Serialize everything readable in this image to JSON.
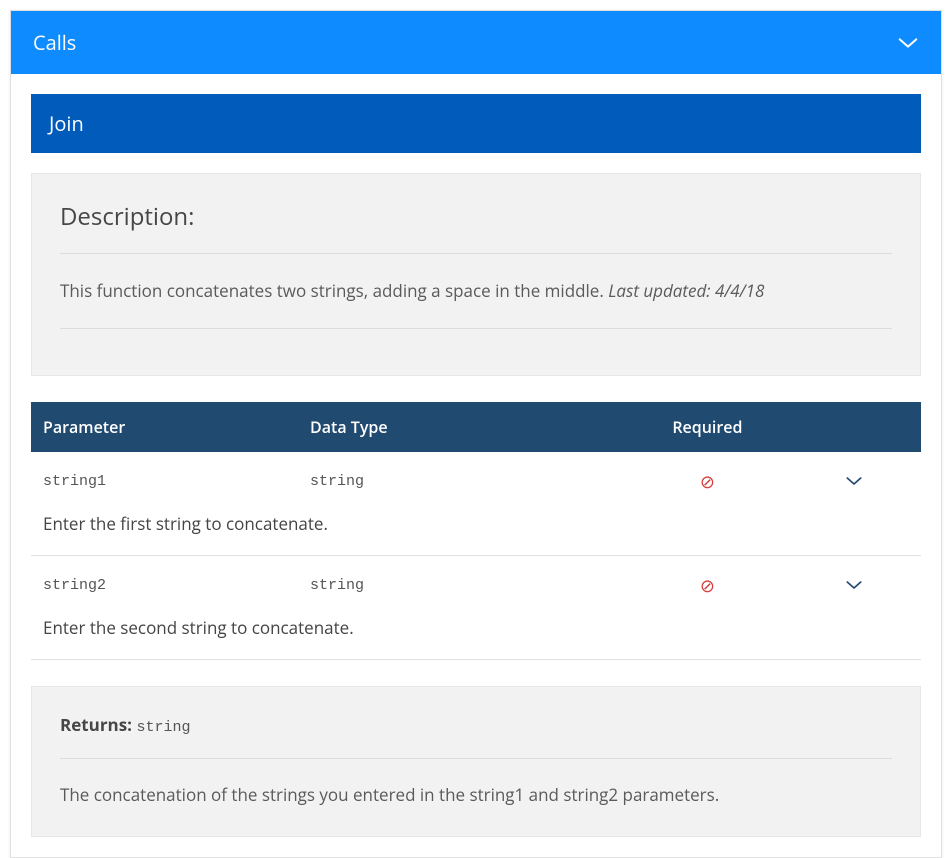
{
  "topbar": {
    "title": "Calls"
  },
  "section": {
    "title": "Join"
  },
  "description": {
    "heading": "Description:",
    "text": "This function concatenates two strings, adding a space in the middle. ",
    "last_updated_prefix": "Last updated: ",
    "last_updated_date": "4/4/18"
  },
  "params_table": {
    "headers": {
      "parameter": "Parameter",
      "data_type": "Data Type",
      "required": "Required"
    },
    "rows": [
      {
        "name": "string1",
        "type": "string",
        "required": false,
        "description": "Enter the first string to concatenate."
      },
      {
        "name": "string2",
        "type": "string",
        "required": false,
        "description": "Enter the second string to concatenate."
      }
    ]
  },
  "returns": {
    "label": "Returns:",
    "type": "string",
    "text": "The concatenation of the strings you entered in the string1 and string2 parameters."
  }
}
